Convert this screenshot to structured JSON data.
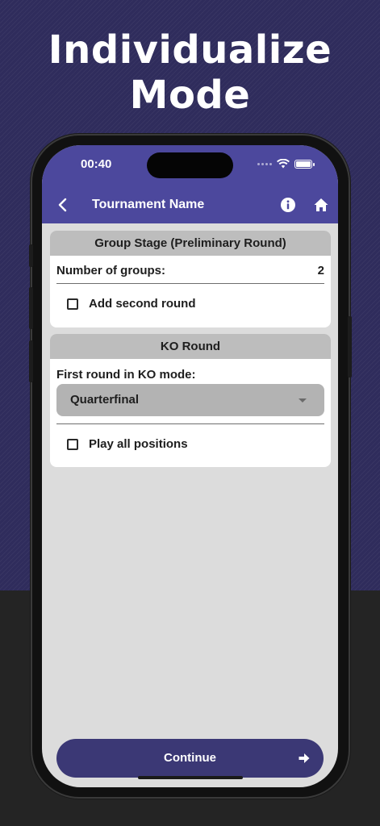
{
  "promo": {
    "headline_line1": "Individualize",
    "headline_line2": "Mode"
  },
  "status_bar": {
    "time": "00:40"
  },
  "app_bar": {
    "title": "Tournament Name",
    "back_icon": "chevron-left-icon",
    "info_icon": "info-icon",
    "home_icon": "home-icon"
  },
  "group_stage": {
    "header": "Group Stage (Preliminary Round)",
    "groups_label": "Number of groups:",
    "groups_value": "2",
    "second_round_label": "Add second round",
    "second_round_checked": false
  },
  "ko_round": {
    "header": "KO Round",
    "first_round_label": "First round in KO mode:",
    "first_round_selected": "Quarterfinal",
    "play_all_label": "Play all positions",
    "play_all_checked": false
  },
  "footer": {
    "continue_label": "Continue",
    "continue_icon": "arrow-right-icon"
  },
  "colors": {
    "background_top": "#2f2c5c",
    "app_bar": "#4c489d",
    "continue_button": "#3b3875",
    "card_header": "#bdbdbd",
    "dropdown": "#b3b3b3",
    "screen_background": "#dcdcdc"
  }
}
